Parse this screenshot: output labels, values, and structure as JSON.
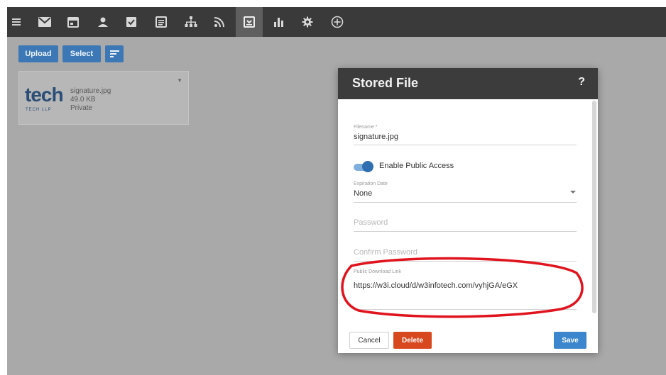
{
  "toolbar": {
    "items": [
      {
        "icon": "menu-icon"
      },
      {
        "icon": "mail-icon"
      },
      {
        "icon": "calendar-icon"
      },
      {
        "icon": "contacts-icon"
      },
      {
        "icon": "tasks-icon"
      },
      {
        "icon": "notes-icon"
      },
      {
        "icon": "org-chart-icon"
      },
      {
        "icon": "rss-icon"
      },
      {
        "icon": "file-storage-icon",
        "active": true
      },
      {
        "icon": "reports-icon"
      },
      {
        "icon": "settings-icon"
      },
      {
        "icon": "add-icon"
      }
    ]
  },
  "actions": {
    "upload_label": "Upload",
    "select_label": "Select",
    "sort_icon": "sort-icon"
  },
  "file_card": {
    "logo_text": "tech",
    "logo_subtext": "TECH LLP",
    "name": "signature.jpg",
    "size": "49.0 KB",
    "visibility": "Private"
  },
  "modal": {
    "title": "Stored File",
    "help": "?",
    "filename_label": "Filename *",
    "filename_value": "signature.jpg",
    "public_access_label": "Enable Public Access",
    "public_access_enabled": true,
    "expiration_label": "Expiration Date",
    "expiration_value": "None",
    "password_placeholder": "Password",
    "confirm_password_placeholder": "Confirm Password",
    "public_link_label": "Public Download Link",
    "public_link_value": "https://w3i.cloud/d/w3infotech.com/vyhjGA/eGX",
    "cancel_label": "Cancel",
    "delete_label": "Delete",
    "save_label": "Save"
  },
  "colors": {
    "toolbar_bg": "#3a3a3a",
    "accent_blue": "#3b78b5",
    "delete_red": "#d8481f",
    "annotation_red": "#e0141e"
  }
}
